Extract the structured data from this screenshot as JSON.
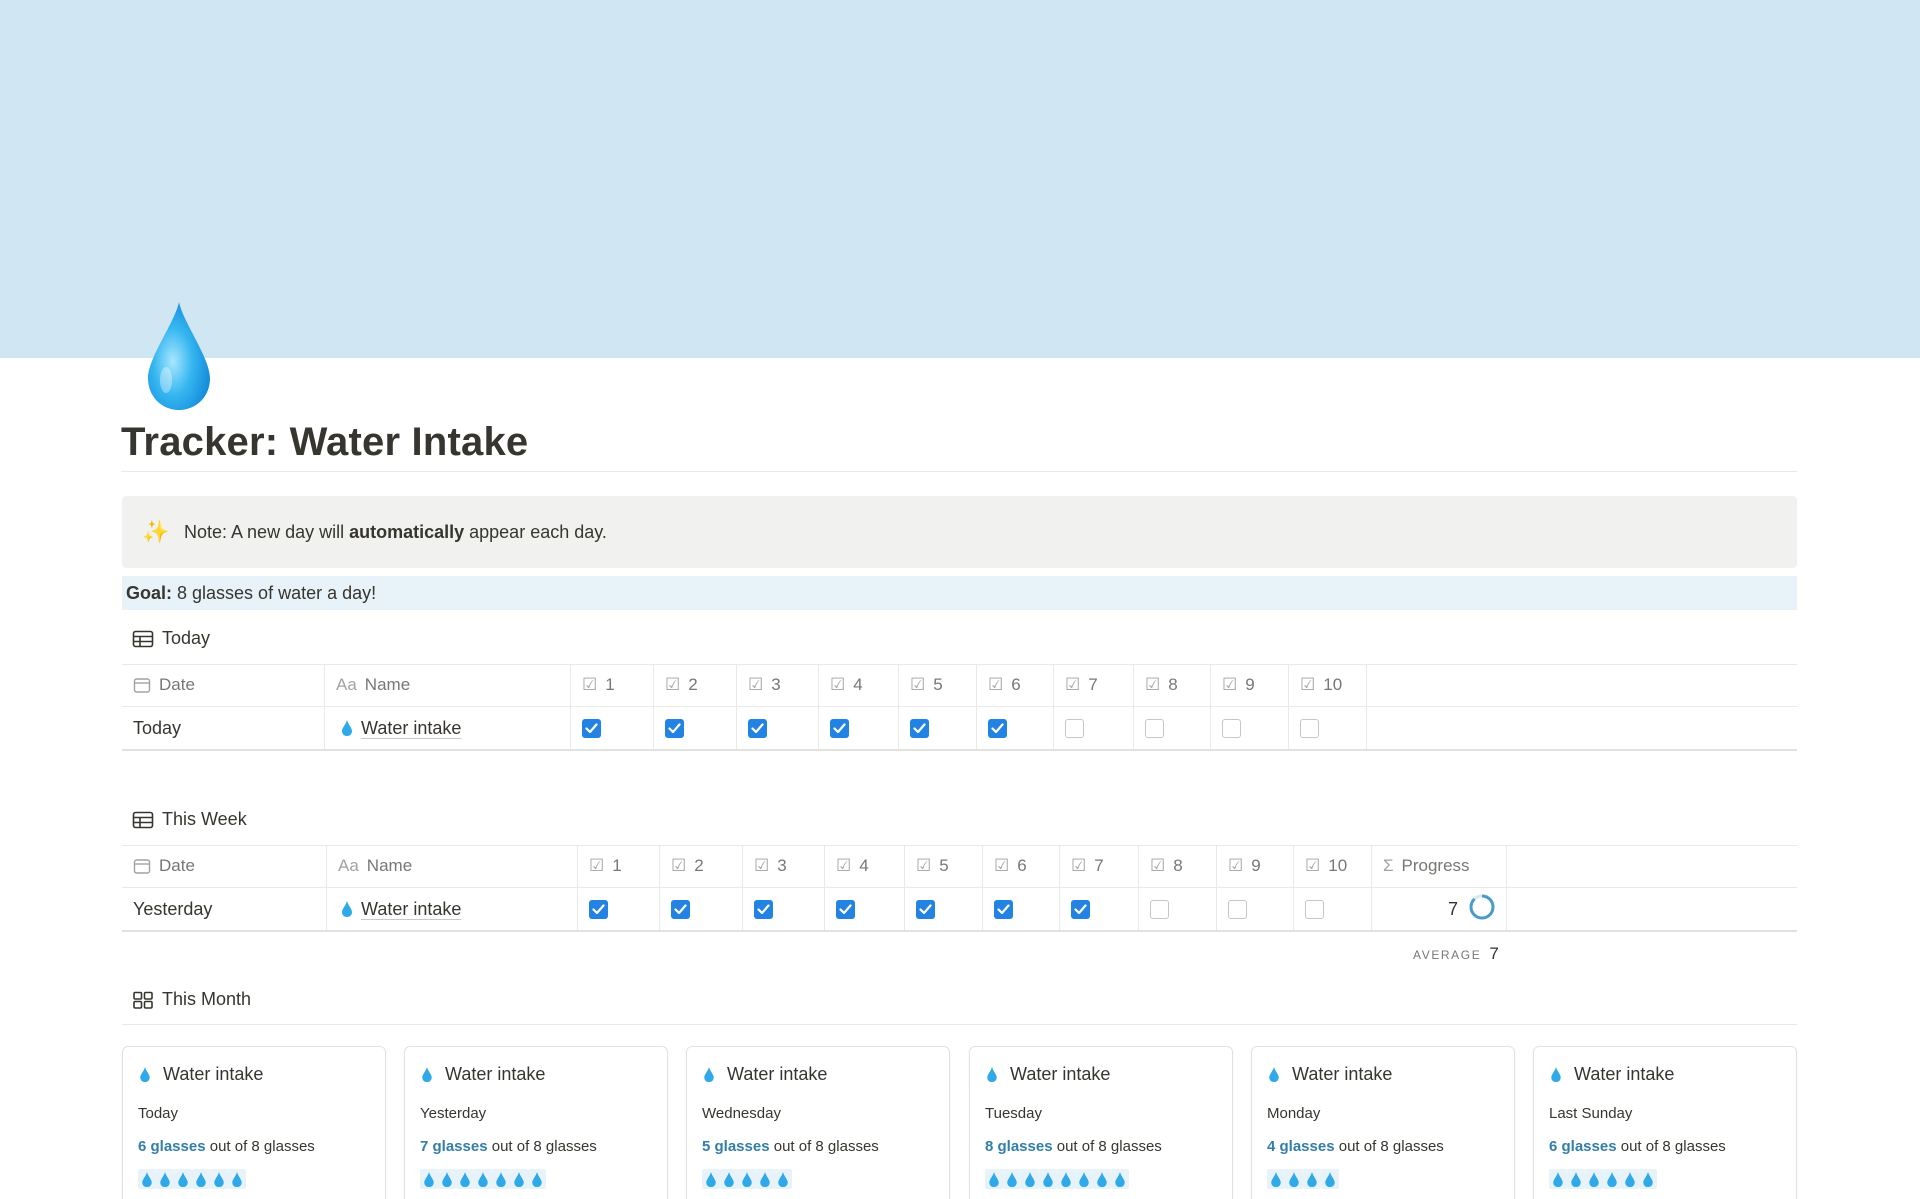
{
  "page": {
    "title": "Tracker: Water Intake",
    "icon": "water-drop-icon",
    "cover_color": "#d0e6f2"
  },
  "callout": {
    "icon": "sparkles-icon",
    "text_before": "Note: A new day will ",
    "text_bold": "automatically",
    "text_after": " appear each day."
  },
  "goal": {
    "label": "Goal:",
    "text": "8 glasses of water a day!"
  },
  "today_view": {
    "title": "Today",
    "columns": {
      "date": "Date",
      "name": "Name",
      "checks": [
        "1",
        "2",
        "3",
        "4",
        "5",
        "6",
        "7",
        "8",
        "9",
        "10"
      ]
    },
    "rows": [
      {
        "date": "Today",
        "name": "Water intake",
        "checks": [
          true,
          true,
          true,
          true,
          true,
          true,
          false,
          false,
          false,
          false
        ]
      }
    ]
  },
  "week_view": {
    "title": "This Week",
    "columns": {
      "date": "Date",
      "name": "Name",
      "checks": [
        "1",
        "2",
        "3",
        "4",
        "5",
        "6",
        "7",
        "8",
        "9",
        "10"
      ],
      "progress": "Progress"
    },
    "rows": [
      {
        "date": "Yesterday",
        "name": "Water intake",
        "checks": [
          true,
          true,
          true,
          true,
          true,
          true,
          true,
          false,
          false,
          false
        ],
        "progress": "7"
      }
    ],
    "average_label": "AVERAGE",
    "average_value": "7"
  },
  "month_view": {
    "title": "This Month",
    "cards": [
      {
        "title": "Water intake",
        "day": "Today",
        "count": "6 glasses",
        "suffix": " out of 8 glasses",
        "drops": 6
      },
      {
        "title": "Water intake",
        "day": "Yesterday",
        "count": "7 glasses",
        "suffix": " out of 8 glasses",
        "drops": 7
      },
      {
        "title": "Water intake",
        "day": "Wednesday",
        "count": "5 glasses",
        "suffix": " out of 8 glasses",
        "drops": 5
      },
      {
        "title": "Water intake",
        "day": "Tuesday",
        "count": "8 glasses",
        "suffix": " out of 8 glasses",
        "drops": 8
      },
      {
        "title": "Water intake",
        "day": "Monday",
        "count": "4 glasses",
        "suffix": " out of 8 glasses",
        "drops": 4
      },
      {
        "title": "Water intake",
        "day": "Last Sunday",
        "count": "6 glasses",
        "suffix": " out of 8 glasses",
        "drops": 6
      }
    ]
  },
  "colors": {
    "accent": "#2383e2",
    "link_blue": "#337ea9",
    "callout_bg": "#f1f1ef",
    "goal_bg": "#e7f3f8"
  }
}
